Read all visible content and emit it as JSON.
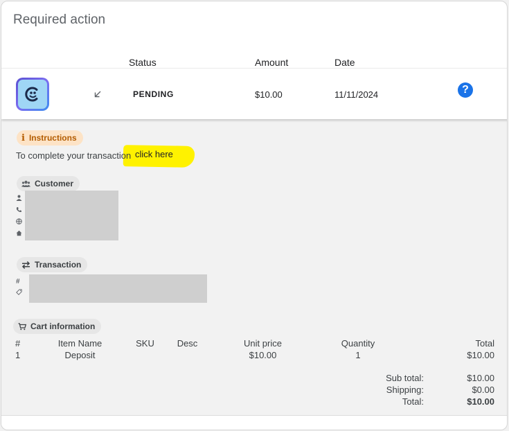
{
  "card": {
    "title": "Required action"
  },
  "columns": {
    "status": "Status",
    "amount": "Amount",
    "date": "Date"
  },
  "transaction_row": {
    "status": "PENDING",
    "amount": "$10.00",
    "date": "11/11/2024",
    "direction_icon": "arrow-down-left-icon",
    "help_icon": "help-icon",
    "help_glyph": "?"
  },
  "instructions": {
    "chip_label": "Instructions",
    "text": "To complete your transaction",
    "link_label": "click here"
  },
  "customer": {
    "chip_label": "Customer",
    "field_icons": [
      "person-icon",
      "phone-icon",
      "globe-icon",
      "home-icon"
    ]
  },
  "transaction": {
    "chip_label": "Transaction",
    "field_icons": [
      "hash-icon",
      "tag-icon"
    ]
  },
  "cart": {
    "chip_label": "Cart information",
    "headers": [
      "#",
      "Item Name",
      "SKU",
      "Desc",
      "Unit price",
      "Quantity",
      "Total"
    ],
    "rows": [
      [
        "1",
        "Deposit",
        "",
        "",
        "$10.00",
        "1",
        "$10.00"
      ]
    ],
    "subtotal_label": "Sub total:",
    "subtotal_value": "$10.00",
    "shipping_label": "Shipping:",
    "shipping_value": "$0.00",
    "total_label": "Total:",
    "total_value": "$10.00"
  },
  "colors": {
    "accent": "#1a73e8",
    "instructions_chip_bg": "#fde3c6",
    "instructions_chip_fg": "#b35c00",
    "highlight": "#fff200"
  }
}
